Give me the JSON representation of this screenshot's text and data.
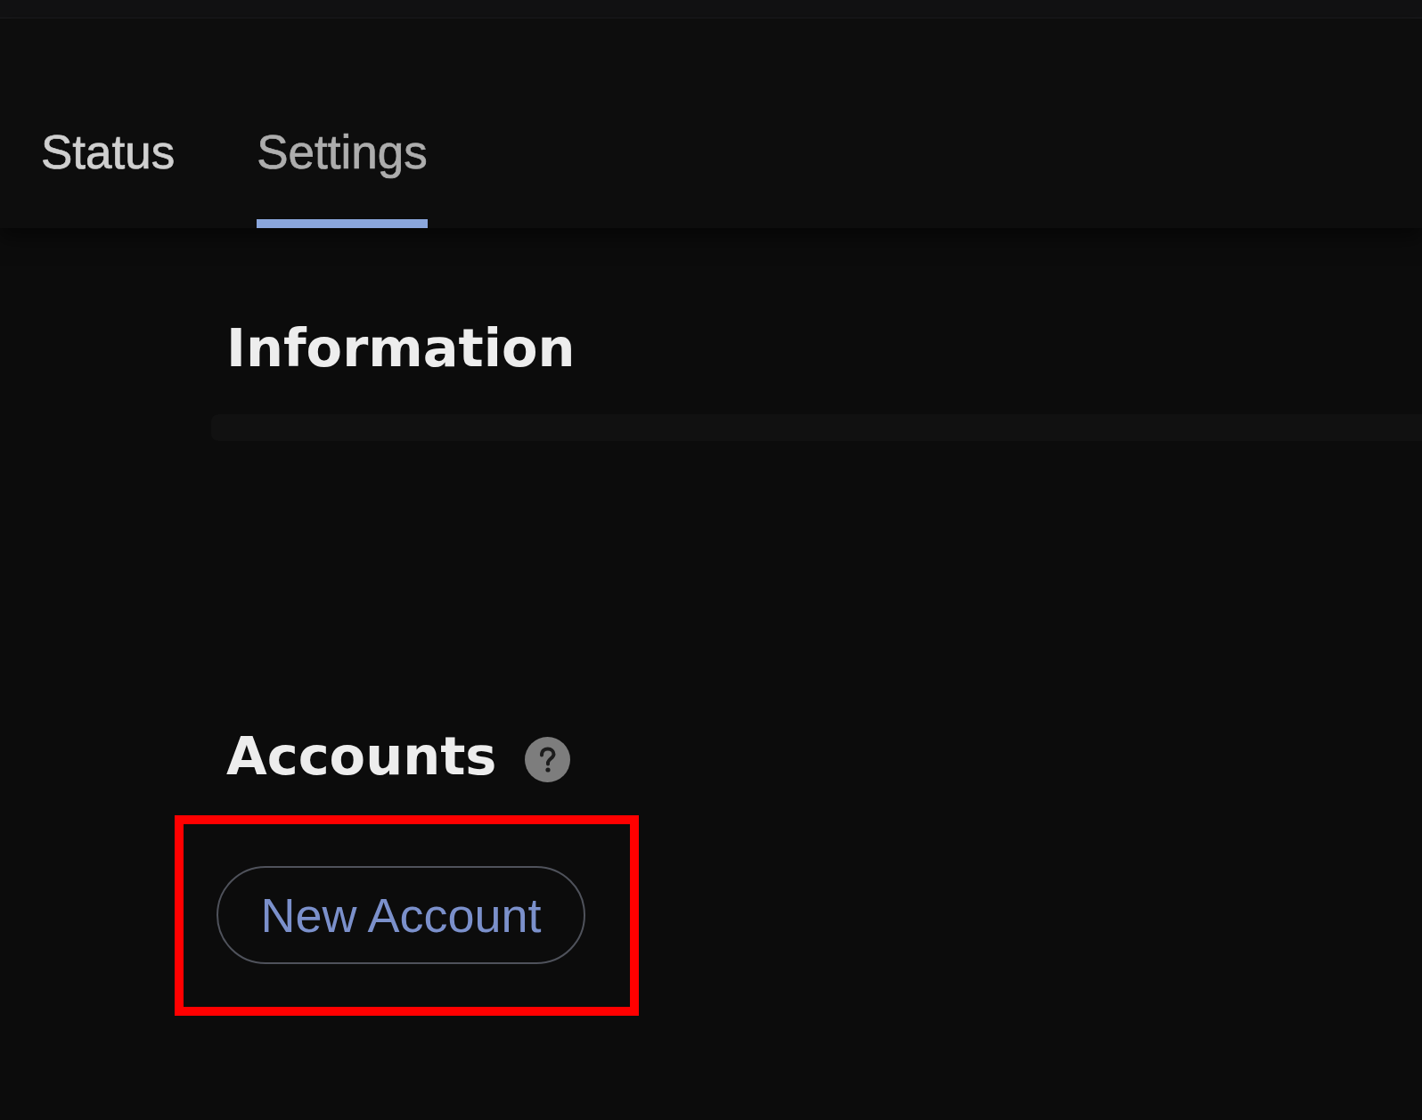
{
  "tabs": [
    {
      "label": "Status",
      "selected": false
    },
    {
      "label": "Settings",
      "selected": true
    }
  ],
  "information": {
    "title": "Information"
  },
  "accounts": {
    "title": "Accounts",
    "help_icon": true,
    "new_account_button": {
      "label": "New Account",
      "highlighted": true
    }
  }
}
